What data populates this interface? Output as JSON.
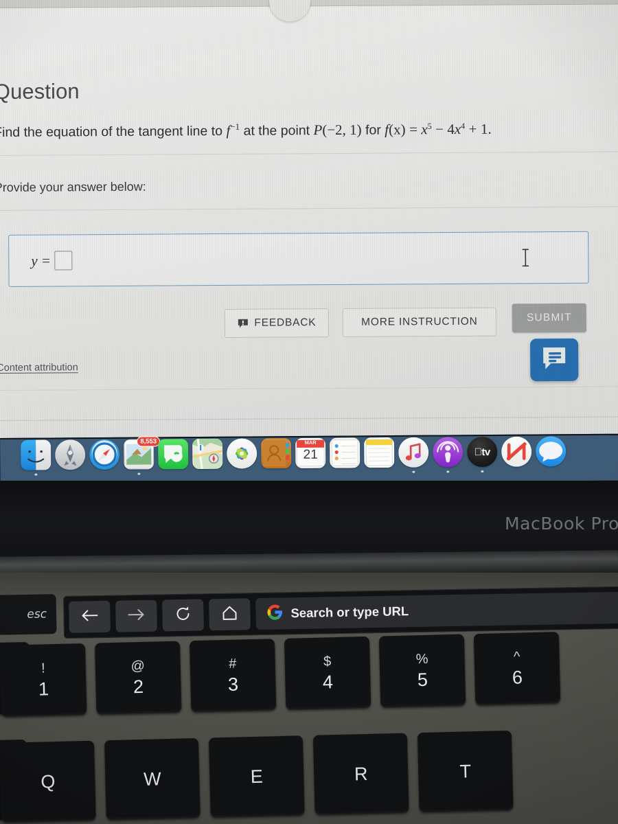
{
  "screen": {
    "nav": {
      "scroll_chevron_icon": "chevron-down-icon"
    },
    "question": {
      "heading": "Question",
      "prompt_part1": "Find the equation of the tangent line to",
      "prompt_inverse": "f",
      "prompt_inverse_sup": "−1",
      "prompt_part2": "at the point",
      "point_label": "P",
      "point_value": "(−2, 1)",
      "prompt_part3": "for",
      "func_name": "f",
      "func_arg": "(x)",
      "equals": "=",
      "term1_base": "x",
      "term1_exp": "5",
      "minus": "−",
      "term2_coef": "4",
      "term2_base": "x",
      "term2_exp": "4",
      "plus": "+",
      "term3": "1",
      "period": "."
    },
    "answer": {
      "provide_label": "Provide your answer below:",
      "equation_lhs": "y =",
      "input_value": "",
      "cursor_icon": "i-beam-text-cursor-icon"
    },
    "buttons": {
      "feedback_label": "FEEDBACK",
      "feedback_icon": "speech-bubble-icon",
      "more_instruction_label": "MORE INSTRUCTION",
      "submit_label": "SUBMIT"
    },
    "chat_widget": {
      "icon": "chat-bubble-icon"
    },
    "attribution_link": "Content attribution"
  },
  "dock": {
    "items": [
      {
        "name": "Finder",
        "icon": "finder-icon",
        "running": true,
        "badge": ""
      },
      {
        "name": "Launchpad",
        "icon": "launchpad-icon",
        "running": false,
        "badge": ""
      },
      {
        "name": "Safari",
        "icon": "safari-icon",
        "running": false,
        "badge": ""
      },
      {
        "name": "Mail",
        "icon": "mail-icon",
        "running": true,
        "badge": "8,553"
      },
      {
        "name": "Messages",
        "icon": "messages-icon",
        "running": false,
        "badge": ""
      },
      {
        "name": "Maps",
        "icon": "maps-icon",
        "running": false,
        "badge": ""
      },
      {
        "name": "Photos",
        "icon": "photos-icon",
        "running": false,
        "badge": ""
      },
      {
        "name": "Contacts",
        "icon": "contacts-icon",
        "running": false,
        "badge": ""
      },
      {
        "name": "Calendar",
        "icon": "calendar-icon",
        "running": false,
        "badge": "",
        "calendar_month": "MAR",
        "calendar_day": "21"
      },
      {
        "name": "Reminders",
        "icon": "reminders-icon",
        "running": false,
        "badge": ""
      },
      {
        "name": "Notes",
        "icon": "notes-icon",
        "running": false,
        "badge": ""
      },
      {
        "name": "Music",
        "icon": "music-icon",
        "running": true,
        "badge": ""
      },
      {
        "name": "Podcasts",
        "icon": "podcasts-icon",
        "running": true,
        "badge": ""
      },
      {
        "name": "Apple TV",
        "icon": "appletv-icon",
        "running": true,
        "badge": "",
        "label": "tv"
      },
      {
        "name": "News",
        "icon": "news-icon",
        "running": false,
        "badge": ""
      },
      {
        "name": "Messages 2",
        "icon": "messages-blue-icon",
        "running": false,
        "badge": ""
      }
    ]
  },
  "laptop": {
    "model_label": "MacBook Pro"
  },
  "touchbar": {
    "esc_label": "esc",
    "controls": [
      {
        "name": "back",
        "icon": "arrow-left-icon"
      },
      {
        "name": "forward",
        "icon": "arrow-right-icon"
      },
      {
        "name": "reload",
        "icon": "reload-icon"
      },
      {
        "name": "home",
        "icon": "home-icon"
      }
    ],
    "omnibox": {
      "icon": "google-g-icon",
      "placeholder": "Search or type URL"
    }
  },
  "keyboard": {
    "tilde_key": "~",
    "number_row": [
      {
        "sym": "!",
        "num": "1"
      },
      {
        "sym": "@",
        "num": "2"
      },
      {
        "sym": "#",
        "num": "3"
      },
      {
        "sym": "$",
        "num": "4"
      },
      {
        "sym": "%",
        "num": "5"
      },
      {
        "sym": "^",
        "num": "6"
      }
    ],
    "alpha_row": [
      {
        "ltr": "Q"
      },
      {
        "ltr": "W"
      },
      {
        "ltr": "E"
      },
      {
        "ltr": "R"
      },
      {
        "ltr": "T"
      }
    ]
  },
  "colors": {
    "screen_bg": "#ececeb",
    "answer_border": "#6f9fcb",
    "submit_bg": "#a3a5a4",
    "chat_blue": "#2a75bb",
    "dock_bg": "#3e5b77",
    "badge_red": "#e8453c"
  }
}
